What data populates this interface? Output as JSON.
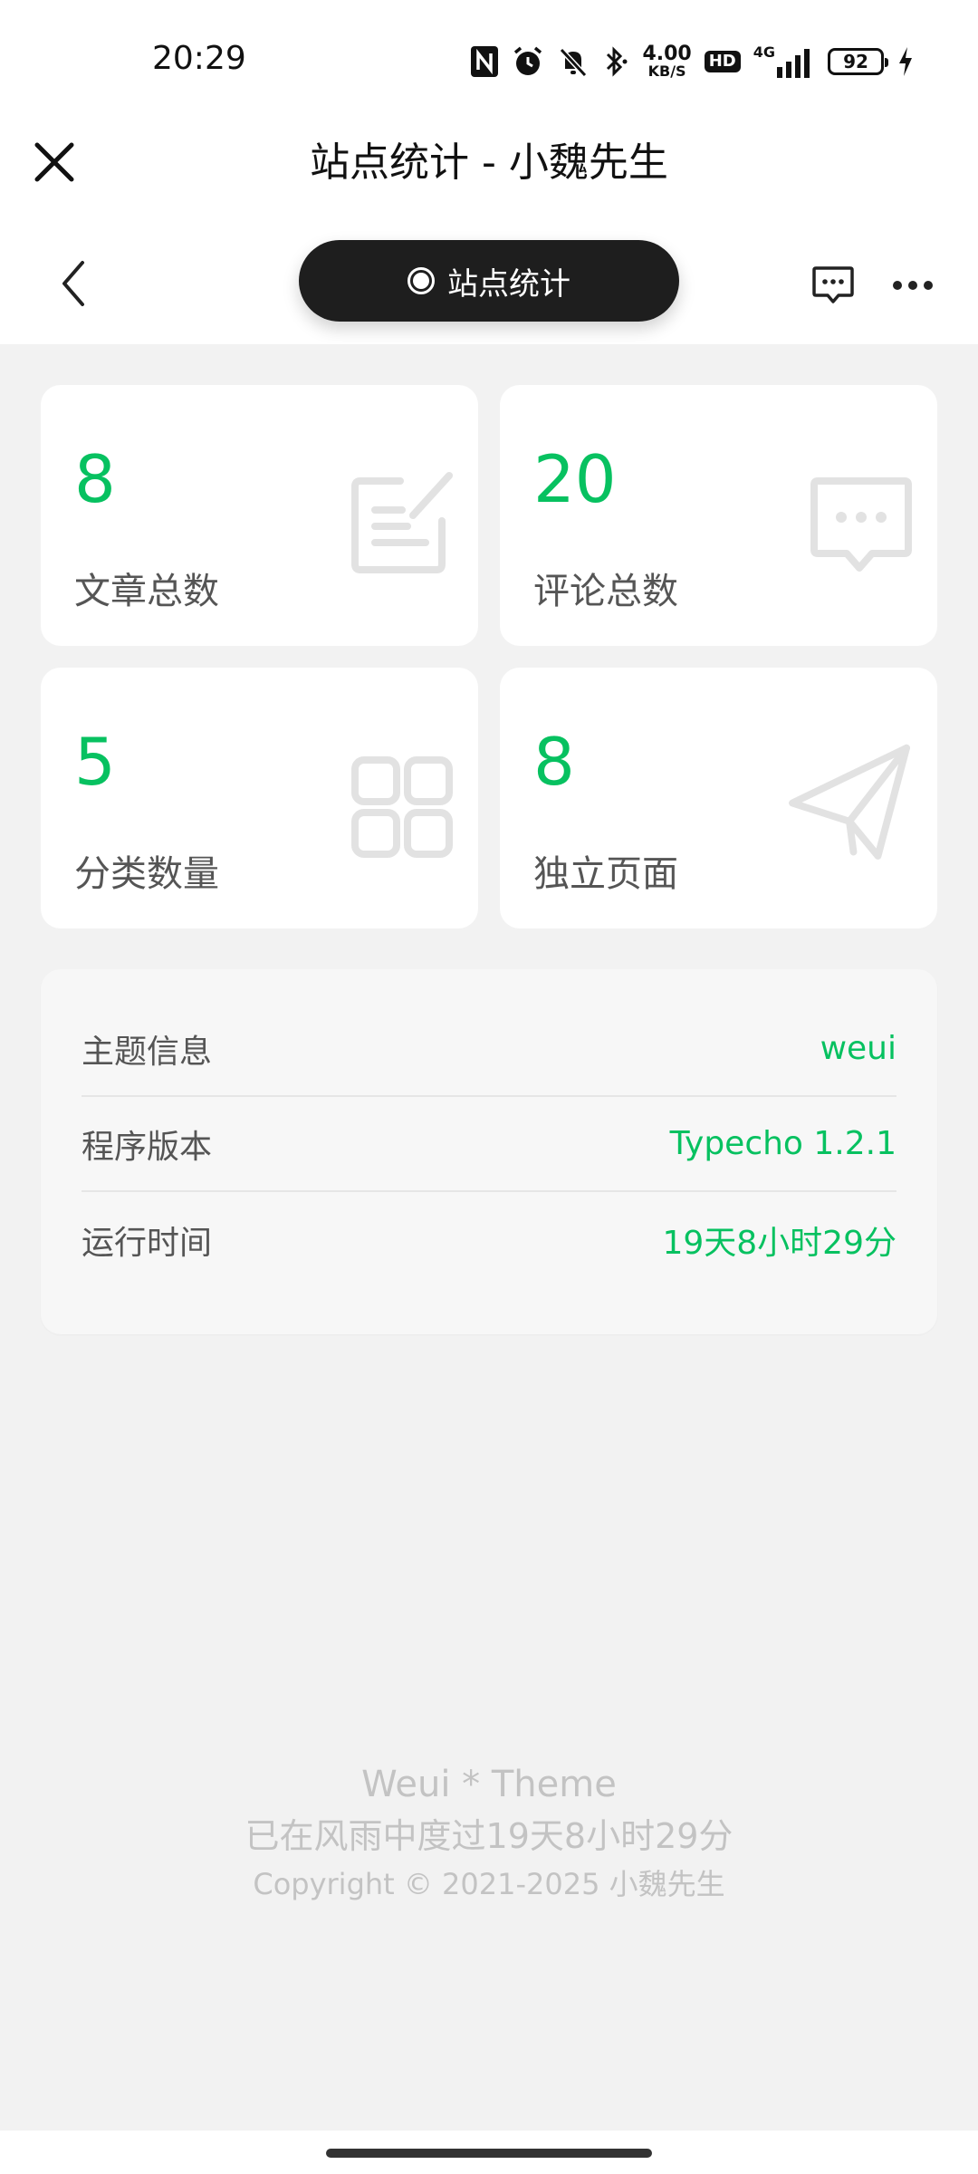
{
  "status_bar": {
    "time": "20:29",
    "net_speed_value": "4.00",
    "net_speed_unit": "KB/S",
    "hd_label": "HD",
    "network_label": "4G",
    "battery": "92"
  },
  "title_bar": {
    "title": "站点统计 - 小魏先生"
  },
  "nav": {
    "pill_label": "站点统计"
  },
  "stats": [
    {
      "value": "8",
      "label": "文章总数",
      "icon": "edit-icon"
    },
    {
      "value": "20",
      "label": "评论总数",
      "icon": "comment-icon"
    },
    {
      "value": "5",
      "label": "分类数量",
      "icon": "grid-icon"
    },
    {
      "value": "8",
      "label": "独立页面",
      "icon": "paper-plane-icon"
    }
  ],
  "info": [
    {
      "key": "主题信息",
      "value": "weui"
    },
    {
      "key": "程序版本",
      "value": "Typecho 1.2.1"
    },
    {
      "key": "运行时间",
      "value": "19天8小时29分"
    }
  ],
  "footer": {
    "line1": "Weui * Theme",
    "line2": "已在风雨中度过19天8小时29分",
    "line3": "Copyright © 2021-2025 小魏先生"
  },
  "colors": {
    "accent": "#07c160",
    "pill_bg": "#1e1e1e",
    "page_bg": "#f2f2f2"
  }
}
